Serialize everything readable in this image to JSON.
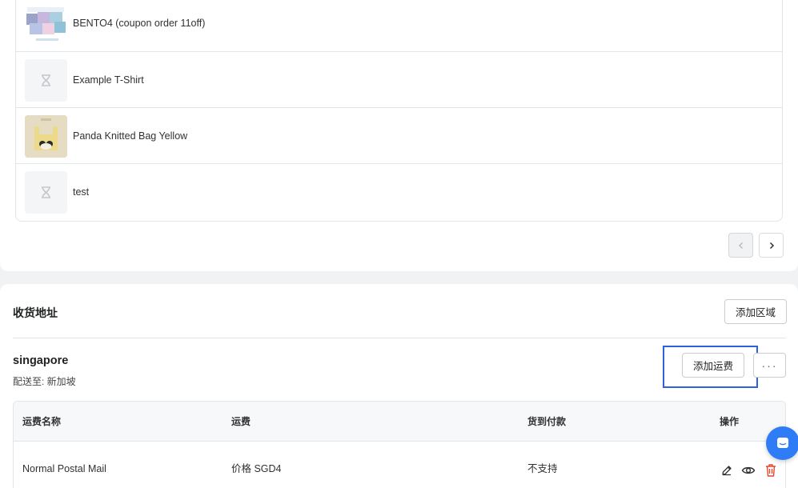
{
  "products": [
    {
      "name": "BENTO4 (coupon order 11off)",
      "thumb": "bento-box-image"
    },
    {
      "name": "Example T-Shirt",
      "thumb": "hourglass-placeholder-icon"
    },
    {
      "name": "Panda Knitted Bag Yellow",
      "thumb": "panda-bag-image"
    },
    {
      "name": "test",
      "thumb": "hourglass-placeholder-icon"
    }
  ],
  "pagination": {
    "prev_icon": "chevron-left-icon",
    "next_icon": "chevron-right-icon"
  },
  "shipping": {
    "title": "收货地址",
    "add_zone_label": "添加区域",
    "zone": {
      "name": "singapore",
      "ship_to": "配送至: 新加坡",
      "add_rate_label": "添加运费",
      "more_label": "···"
    },
    "table": {
      "headers": [
        "运费名称",
        "运费",
        "货到付款",
        "操作"
      ],
      "rows": [
        {
          "name": "Normal Postal Mail",
          "price": "价格 SGD4",
          "cod": "不支持"
        }
      ]
    }
  },
  "colors": {
    "accent": "#2c62e0",
    "delete": "#e2472d",
    "chat": "#2f7df6"
  }
}
